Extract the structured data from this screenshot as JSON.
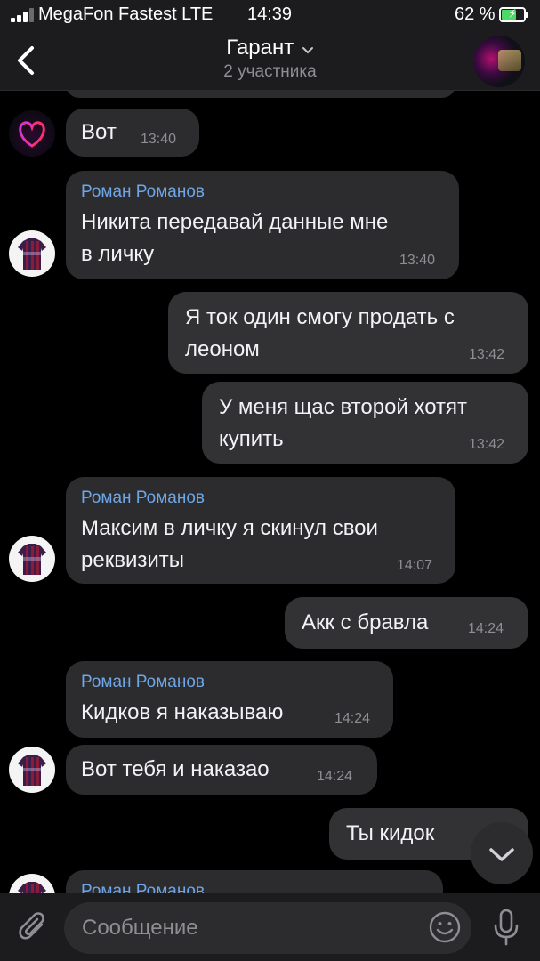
{
  "status_bar": {
    "carrier": "MegaFon Fastest LTE",
    "time": "14:39",
    "battery": "62 %",
    "battery_level": 0.62
  },
  "header": {
    "title": "Гарант",
    "subtitle": "2 участника"
  },
  "messages": [
    {
      "direction": "in",
      "sender": "",
      "text": "Вот",
      "time": "13:40"
    },
    {
      "direction": "in",
      "sender": "Роман Романов",
      "text_lines": [
        "Никита передавай данные мне",
        "в личку"
      ],
      "time": "13:40"
    },
    {
      "direction": "out",
      "text_lines": [
        "Я ток один смогу продать с",
        "леоном"
      ],
      "time": "13:42"
    },
    {
      "direction": "out",
      "text_lines": [
        "У меня щас второй хотят",
        "купить"
      ],
      "time": "13:42"
    },
    {
      "direction": "in",
      "sender": "Роман Романов",
      "text_lines": [
        "Максим в личку я скинул свои",
        "реквизиты"
      ],
      "time": "14:07"
    },
    {
      "direction": "out",
      "text": "Акк с бравла",
      "time": "14:24"
    },
    {
      "direction": "in",
      "sender": "Роман Романов",
      "text": "Кидков я наказываю",
      "time": "14:24"
    },
    {
      "direction": "in",
      "sender": "",
      "text": "Вот тебя и наказао",
      "time": "14:24"
    },
    {
      "direction": "out",
      "text": "Ты кидок",
      "time": ""
    },
    {
      "direction": "in",
      "sender": "Роман Романов",
      "text": "",
      "time": ""
    }
  ],
  "composer": {
    "placeholder": "Сообщение"
  },
  "colors": {
    "background": "#000000",
    "bar": "#1c1c1e",
    "bubble": "#2c2c2e",
    "sender_name": "#6ea6e8",
    "timestamp": "#8e8e93",
    "battery_fill": "#4cd964"
  },
  "icons": [
    "back-chevron-icon",
    "chevron-down-icon",
    "paperclip-icon",
    "emoji-icon",
    "microphone-icon",
    "scroll-down-icon"
  ]
}
